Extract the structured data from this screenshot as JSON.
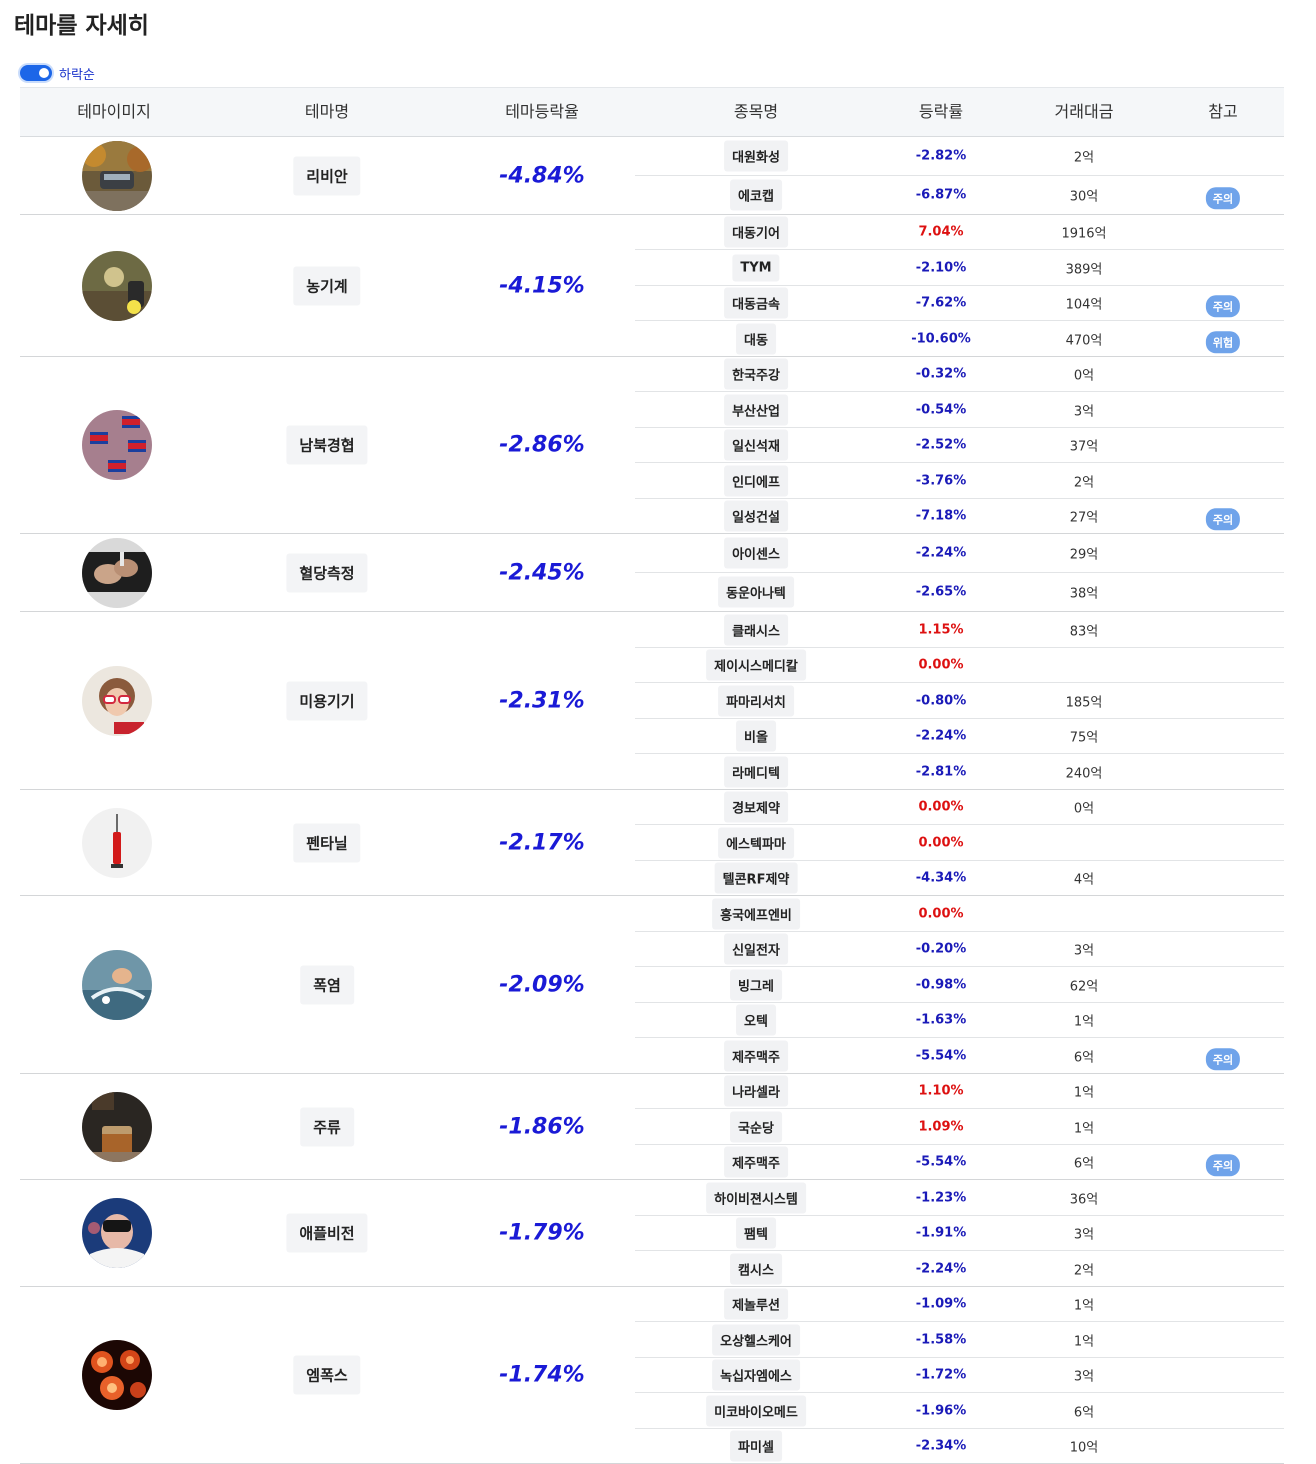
{
  "page": {
    "title": "테마를 자세히"
  },
  "toggle": {
    "label": "하락순",
    "on": true
  },
  "colors": {
    "negative": "#1a1ab8",
    "positive": "#dd1111",
    "theme_rate": "#1a1ad6",
    "badge": "#6fa3ea",
    "toggle_accent": "#1c66e8"
  },
  "table": {
    "headers": [
      "테마이미지",
      "테마명",
      "테마등락율",
      "종목명",
      "등락률",
      "거래대금",
      "참고"
    ],
    "groups": [
      {
        "name": "리비안",
        "rate": "-4.84%",
        "image": "car-photo",
        "stocks": [
          {
            "name": "대원화성",
            "rate": "-2.82%",
            "volume": "2억",
            "badge": ""
          },
          {
            "name": "에코캡",
            "rate": "-6.87%",
            "volume": "30억",
            "badge": "주의"
          }
        ]
      },
      {
        "name": "농기계",
        "rate": "-4.15%",
        "image": "farm-machine-photo",
        "stocks": [
          {
            "name": "대동기어",
            "rate": "7.04%",
            "volume": "1916억",
            "badge": ""
          },
          {
            "name": "TYM",
            "rate": "-2.10%",
            "volume": "389억",
            "badge": ""
          },
          {
            "name": "대동금속",
            "rate": "-7.62%",
            "volume": "104억",
            "badge": "주의"
          },
          {
            "name": "대동",
            "rate": "-10.60%",
            "volume": "470억",
            "badge": "위험"
          }
        ]
      },
      {
        "name": "남북경협",
        "rate": "-2.86%",
        "image": "north-korea-flags-photo",
        "stocks": [
          {
            "name": "한국주강",
            "rate": "-0.32%",
            "volume": "0억",
            "badge": ""
          },
          {
            "name": "부산산업",
            "rate": "-0.54%",
            "volume": "3억",
            "badge": ""
          },
          {
            "name": "일신석재",
            "rate": "-2.52%",
            "volume": "37억",
            "badge": ""
          },
          {
            "name": "인디에프",
            "rate": "-3.76%",
            "volume": "2억",
            "badge": ""
          },
          {
            "name": "일성건설",
            "rate": "-7.18%",
            "volume": "27억",
            "badge": "주의"
          }
        ]
      },
      {
        "name": "혈당측정",
        "rate": "-2.45%",
        "image": "blood-glucose-test-photo",
        "stocks": [
          {
            "name": "아이센스",
            "rate": "-2.24%",
            "volume": "29억",
            "badge": ""
          },
          {
            "name": "동운아나텍",
            "rate": "-2.65%",
            "volume": "38억",
            "badge": ""
          }
        ]
      },
      {
        "name": "미용기기",
        "rate": "-2.31%",
        "image": "beauty-woman-photo",
        "stocks": [
          {
            "name": "클래시스",
            "rate": "1.15%",
            "volume": "83억",
            "badge": ""
          },
          {
            "name": "제이시스메디칼",
            "rate": "0.00%",
            "volume": "",
            "badge": ""
          },
          {
            "name": "파마리서치",
            "rate": "-0.80%",
            "volume": "185억",
            "badge": ""
          },
          {
            "name": "비올",
            "rate": "-2.24%",
            "volume": "75억",
            "badge": ""
          },
          {
            "name": "라메디텍",
            "rate": "-2.81%",
            "volume": "240억",
            "badge": ""
          }
        ]
      },
      {
        "name": "펜타닐",
        "rate": "-2.17%",
        "image": "syringe-photo",
        "stocks": [
          {
            "name": "경보제약",
            "rate": "0.00%",
            "volume": "0억",
            "badge": ""
          },
          {
            "name": "에스텍파마",
            "rate": "0.00%",
            "volume": "",
            "badge": ""
          },
          {
            "name": "텔콘RF제약",
            "rate": "-4.34%",
            "volume": "4억",
            "badge": ""
          }
        ]
      },
      {
        "name": "폭염",
        "rate": "-2.09%",
        "image": "water-splash-photo",
        "stocks": [
          {
            "name": "흥국에프엔비",
            "rate": "0.00%",
            "volume": "",
            "badge": ""
          },
          {
            "name": "신일전자",
            "rate": "-0.20%",
            "volume": "3억",
            "badge": ""
          },
          {
            "name": "빙그레",
            "rate": "-0.98%",
            "volume": "62억",
            "badge": ""
          },
          {
            "name": "오텍",
            "rate": "-1.63%",
            "volume": "1억",
            "badge": ""
          },
          {
            "name": "제주맥주",
            "rate": "-5.54%",
            "volume": "6억",
            "badge": "주의"
          }
        ]
      },
      {
        "name": "주류",
        "rate": "-1.86%",
        "image": "whiskey-glass-photo",
        "stocks": [
          {
            "name": "나라셀라",
            "rate": "1.10%",
            "volume": "1억",
            "badge": ""
          },
          {
            "name": "국순당",
            "rate": "1.09%",
            "volume": "1억",
            "badge": ""
          },
          {
            "name": "제주맥주",
            "rate": "-5.54%",
            "volume": "6억",
            "badge": "주의"
          }
        ]
      },
      {
        "name": "애플비전",
        "rate": "-1.79%",
        "image": "vr-headset-photo",
        "stocks": [
          {
            "name": "하이비젼시스템",
            "rate": "-1.23%",
            "volume": "36억",
            "badge": ""
          },
          {
            "name": "팸텍",
            "rate": "-1.91%",
            "volume": "3억",
            "badge": ""
          },
          {
            "name": "캠시스",
            "rate": "-2.24%",
            "volume": "2억",
            "badge": ""
          }
        ]
      },
      {
        "name": "엠폭스",
        "rate": "-1.74%",
        "image": "virus-cells-photo",
        "stocks": [
          {
            "name": "제놀루션",
            "rate": "-1.09%",
            "volume": "1억",
            "badge": ""
          },
          {
            "name": "오상헬스케어",
            "rate": "-1.58%",
            "volume": "1억",
            "badge": ""
          },
          {
            "name": "녹십자엠에스",
            "rate": "-1.72%",
            "volume": "3억",
            "badge": ""
          },
          {
            "name": "미코바이오메드",
            "rate": "-1.96%",
            "volume": "6억",
            "badge": ""
          },
          {
            "name": "파미셀",
            "rate": "-2.34%",
            "volume": "10억",
            "badge": ""
          }
        ]
      }
    ]
  }
}
